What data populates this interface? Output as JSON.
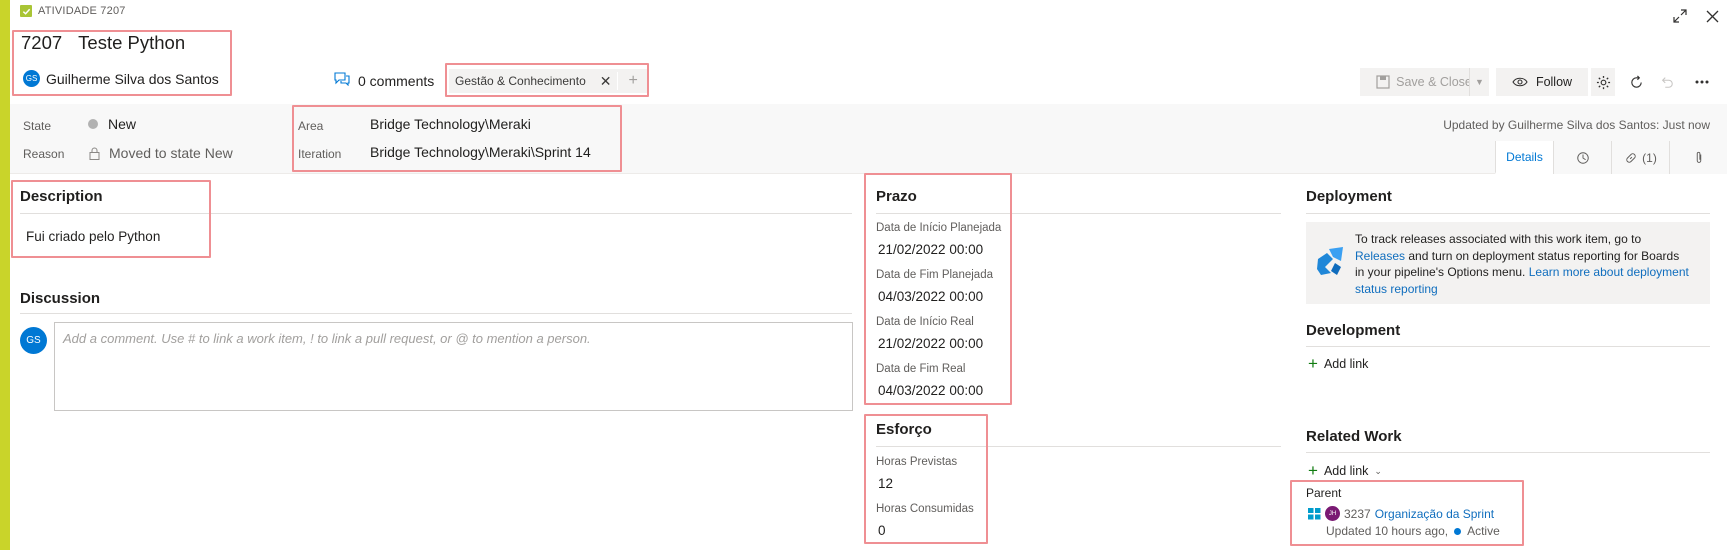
{
  "header": {
    "type_label": "ATIVIDADE 7207",
    "id": "7207",
    "title": "Teste Python",
    "assigned_initials": "GS",
    "assigned_to": "Guilherme Silva dos Santos",
    "comments": "0 comments",
    "tag": "Gestão & Conhecimento"
  },
  "toolbar": {
    "save_close": "Save & Close",
    "follow": "Follow"
  },
  "fields": {
    "state_label": "State",
    "state_value": "New",
    "reason_label": "Reason",
    "reason_value": "Moved to state New",
    "area_label": "Area",
    "area_value": "Bridge Technology\\Meraki",
    "iteration_label": "Iteration",
    "iteration_value": "Bridge Technology\\Meraki\\Sprint 14",
    "updated_by": "Updated by Guilherme Silva dos Santos: Just now"
  },
  "tabs": {
    "details": "Details",
    "links": "(1)"
  },
  "description": {
    "heading": "Description",
    "text": "Fui criado pelo Python"
  },
  "discussion": {
    "heading": "Discussion",
    "avatar": "GS",
    "placeholder": "Add a comment. Use # to link a work item, ! to link a pull request, or @ to mention a person."
  },
  "prazo": {
    "heading": "Prazo",
    "f1_label": "Data de Início Planejada",
    "f1_value": "21/02/2022 00:00",
    "f2_label": "Data de Fim Planejada",
    "f2_value": "04/03/2022 00:00",
    "f3_label": "Data de Início Real",
    "f3_value": "21/02/2022 00:00",
    "f4_label": "Data de Fim Real",
    "f4_value": "04/03/2022 00:00"
  },
  "esforco": {
    "heading": "Esforço",
    "f1_label": "Horas Previstas",
    "f1_value": "12",
    "f2_label": "Horas Consumidas",
    "f2_value": "0"
  },
  "deployment": {
    "heading": "Deployment",
    "t1": "To track releases associated with this work item, go to ",
    "releases": "Releases",
    "t2": "and turn on deployment status reporting for Boards in your pipeline's Options menu. ",
    "learn": "Learn more about deployment status reporting"
  },
  "development": {
    "heading": "Development",
    "add_link": "Add link"
  },
  "related": {
    "heading": "Related Work",
    "add_link": "Add link",
    "parent_label": "Parent",
    "parent_avatar": "JH",
    "parent_id": "3237",
    "parent_title": "Organização da Sprint",
    "parent_updated": "Updated 10 hours ago,",
    "parent_state": "Active"
  },
  "colors": {
    "accent": "#c9d42a",
    "link": "#106ebe",
    "highlight": "#ef8f93",
    "avatar_blue": "#0078d4",
    "avatar_purple": "#7a1a73",
    "active_dot": "#0078d4"
  }
}
